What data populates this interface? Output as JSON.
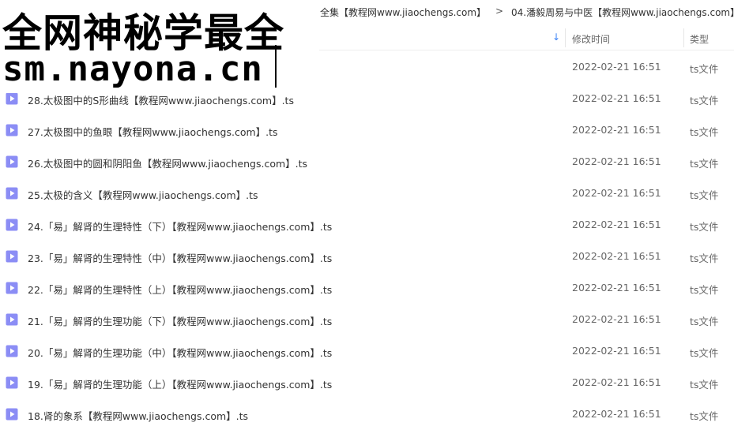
{
  "breadcrumb": {
    "crumb1": "全集【教程网www.jiaochengs.com】",
    "separator": ">",
    "crumb2": "04.潘毅周易与中医【教程网www.jiaochengs.com】"
  },
  "header": {
    "modified_col": "修改时间",
    "type_col": "类型",
    "sort_icon": "arrow-down-icon"
  },
  "files": [
    {
      "name": "",
      "modified": "2022-02-21 16:51",
      "type": "ts文件"
    },
    {
      "name": "28.太极图中的S形曲线【教程网www.jiaochengs.com】.ts",
      "modified": "2022-02-21 16:51",
      "type": "ts文件"
    },
    {
      "name": "27.太极图中的鱼眼【教程网www.jiaochengs.com】.ts",
      "modified": "2022-02-21 16:51",
      "type": "ts文件"
    },
    {
      "name": "26.太极图中的圆和阴阳鱼【教程网www.jiaochengs.com】.ts",
      "modified": "2022-02-21 16:51",
      "type": "ts文件"
    },
    {
      "name": "25.太极的含义【教程网www.jiaochengs.com】.ts",
      "modified": "2022-02-21 16:51",
      "type": "ts文件"
    },
    {
      "name": "24.「易」解肾的生理特性（下）【教程网www.jiaochengs.com】.ts",
      "modified": "2022-02-21 16:51",
      "type": "ts文件"
    },
    {
      "name": "23.「易」解肾的生理特性（中）【教程网www.jiaochengs.com】.ts",
      "modified": "2022-02-21 16:51",
      "type": "ts文件"
    },
    {
      "name": "22.「易」解肾的生理特性（上）【教程网www.jiaochengs.com】.ts",
      "modified": "2022-02-21 16:51",
      "type": "ts文件"
    },
    {
      "name": "21.「易」解肾的生理功能（下）【教程网www.jiaochengs.com】.ts",
      "modified": "2022-02-21 16:51",
      "type": "ts文件"
    },
    {
      "name": "20.「易」解肾的生理功能（中）【教程网www.jiaochengs.com】.ts",
      "modified": "2022-02-21 16:51",
      "type": "ts文件"
    },
    {
      "name": "19.「易」解肾的生理功能（上）【教程网www.jiaochengs.com】.ts",
      "modified": "2022-02-21 16:51",
      "type": "ts文件"
    },
    {
      "name": "18.肾的象系【教程网www.jiaochengs.com】.ts",
      "modified": "2022-02-21 16:51",
      "type": "ts文件"
    }
  ],
  "watermark": {
    "line1": "全网神秘学最全",
    "line2": "sm.nayona.cn"
  },
  "colors": {
    "file_icon": "#8b8df5",
    "sort_arrow": "#3b82f6"
  }
}
